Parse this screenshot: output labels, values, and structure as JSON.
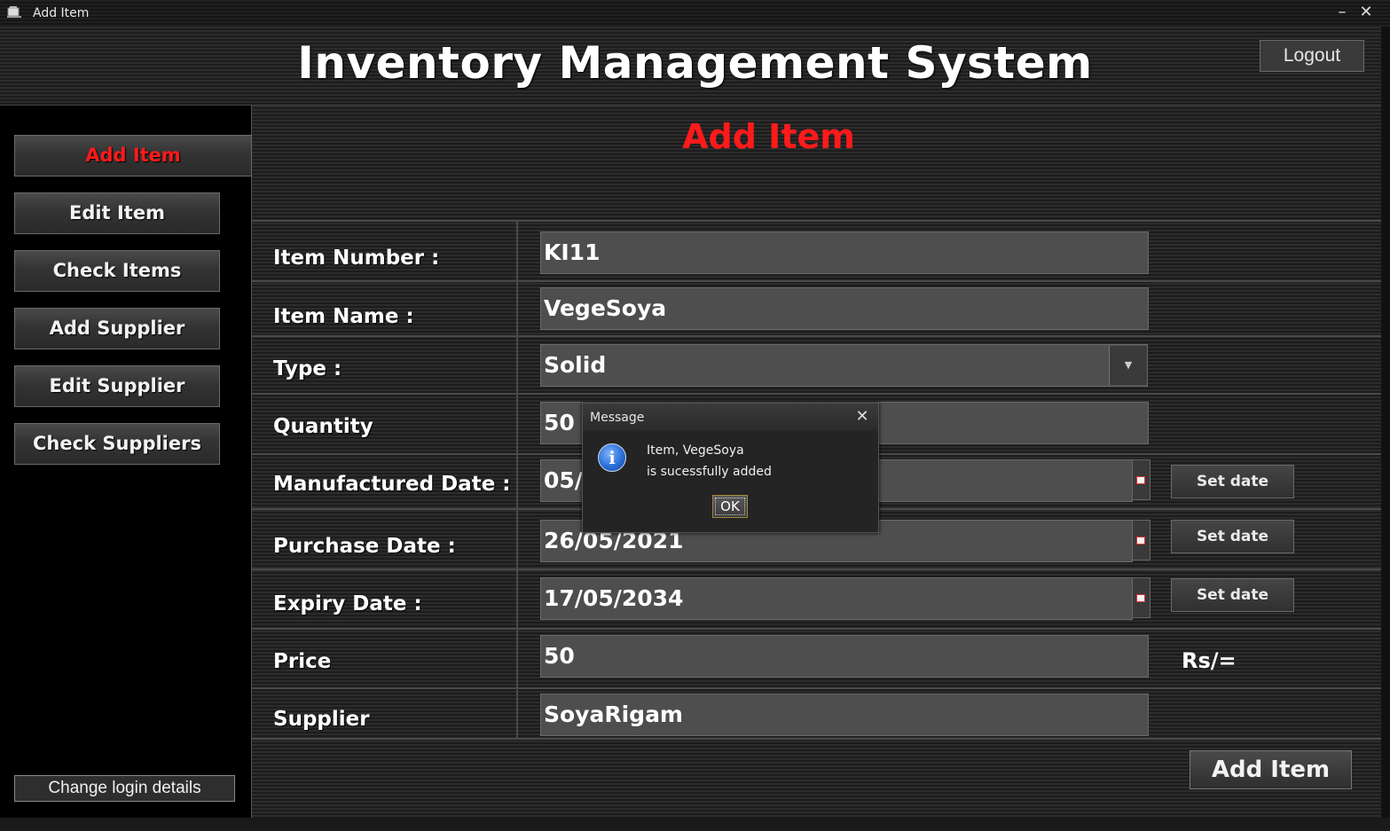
{
  "window": {
    "title": "Add Item",
    "minimize_glyph": "–",
    "close_glyph": "✕"
  },
  "header": {
    "title": "Inventory Management System",
    "logout_label": "Logout"
  },
  "sidebar": {
    "items": [
      {
        "label": "Add Item",
        "active": true
      },
      {
        "label": "Edit Item"
      },
      {
        "label": "Check Items"
      },
      {
        "label": "Add Supplier"
      },
      {
        "label": "Edit Supplier"
      },
      {
        "label": "Check Suppliers"
      }
    ],
    "change_login_label": "Change login details"
  },
  "main": {
    "heading": "Add Item",
    "fields": {
      "item_number": {
        "label": "Item Number :",
        "value": "KI11"
      },
      "item_name": {
        "label": "Item Name :",
        "value": "VegeSoya"
      },
      "type": {
        "label": "Type :",
        "value": "Solid"
      },
      "quantity": {
        "label": "Quantity",
        "value": "50"
      },
      "manufactured_date": {
        "label": "Manufactured Date :",
        "value": "05/"
      },
      "purchase_date": {
        "label": "Purchase Date :",
        "value": "26/05/2021"
      },
      "expiry_date": {
        "label": "Expiry Date :",
        "value": "17/05/2034"
      },
      "price": {
        "label": "Price",
        "value": "50",
        "unit": "Rs/="
      },
      "supplier": {
        "label": "Supplier",
        "value": "SoyaRigam"
      }
    },
    "set_date_label": "Set date",
    "submit_label": "Add Item"
  },
  "dialog": {
    "title": "Message",
    "close_glyph": "✕",
    "icon_glyph": "i",
    "line1": "Item, VegeSoya",
    "line2": "is sucessfully added",
    "ok_label": "OK"
  },
  "colors": {
    "accent_red": "#ff1a1a",
    "background": "#262626",
    "sidebar": "#000000"
  }
}
